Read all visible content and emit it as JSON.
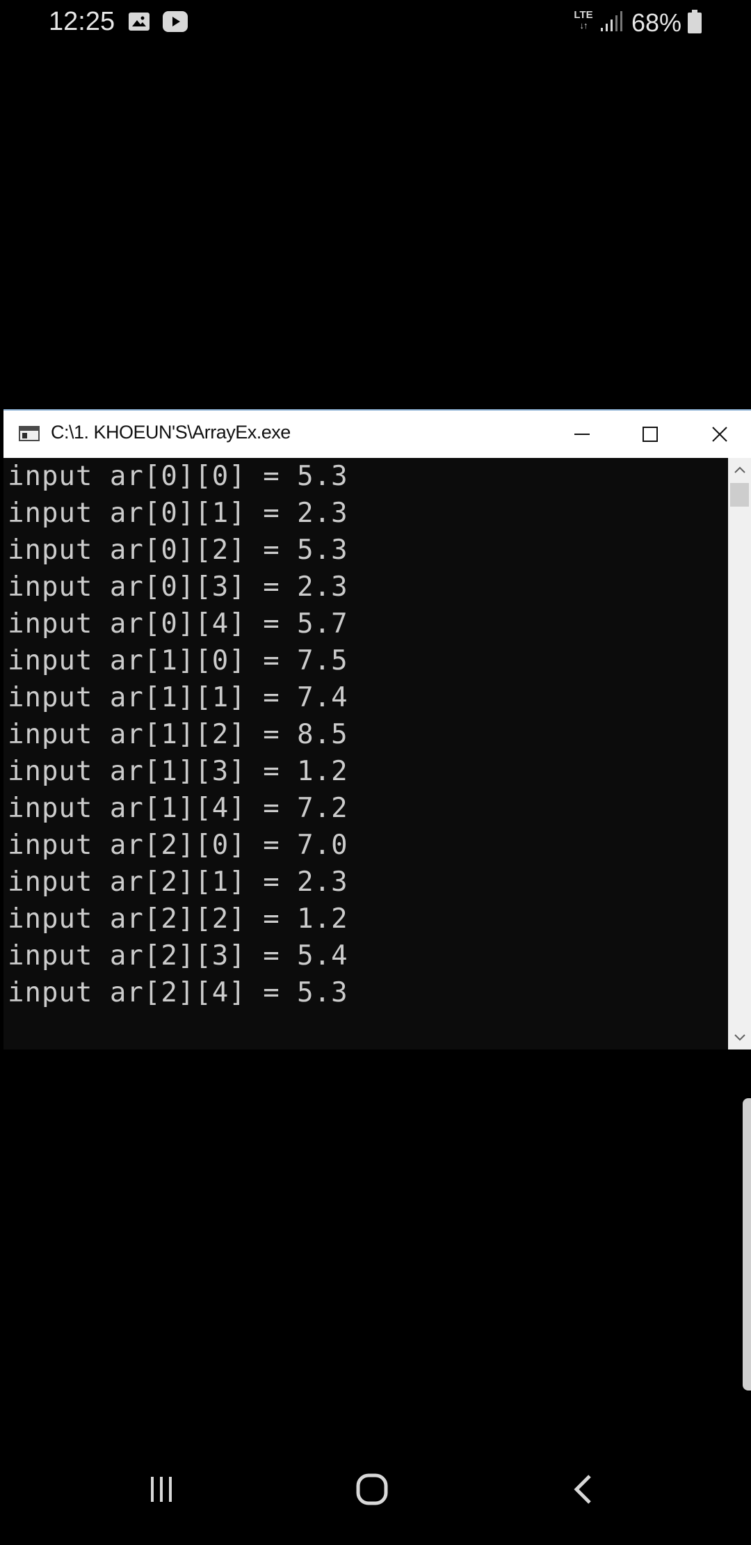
{
  "status_bar": {
    "time": "12:25",
    "notification_icons": [
      "gallery-icon",
      "youtube-icon"
    ],
    "network_type": "LTE",
    "battery_percent": "68%"
  },
  "window": {
    "title": "C:\\1. KHOEUN'S\\ArrayEx.exe",
    "buttons": [
      "minimize",
      "maximize",
      "close"
    ],
    "title_bar_color": "#ffffff",
    "console_background": "#0c0c0c",
    "console_text_color": "#cccccc"
  },
  "console": {
    "lines": [
      "input ar[0][0] = 5.3",
      "input ar[0][1] = 2.3",
      "input ar[0][2] = 5.3",
      "input ar[0][3] = 2.3",
      "input ar[0][4] = 5.7",
      "input ar[1][0] = 7.5",
      "input ar[1][1] = 7.4",
      "input ar[1][2] = 8.5",
      "input ar[1][3] = 1.2",
      "input ar[1][4] = 7.2",
      "input ar[2][0] = 7.0",
      "input ar[2][1] = 2.3",
      "input ar[2][2] = 1.2",
      "input ar[2][3] = 5.4",
      "input ar[2][4] = 5.3"
    ]
  },
  "nav_bar": {
    "buttons": [
      "recents-icon",
      "home-icon",
      "back-icon"
    ]
  }
}
